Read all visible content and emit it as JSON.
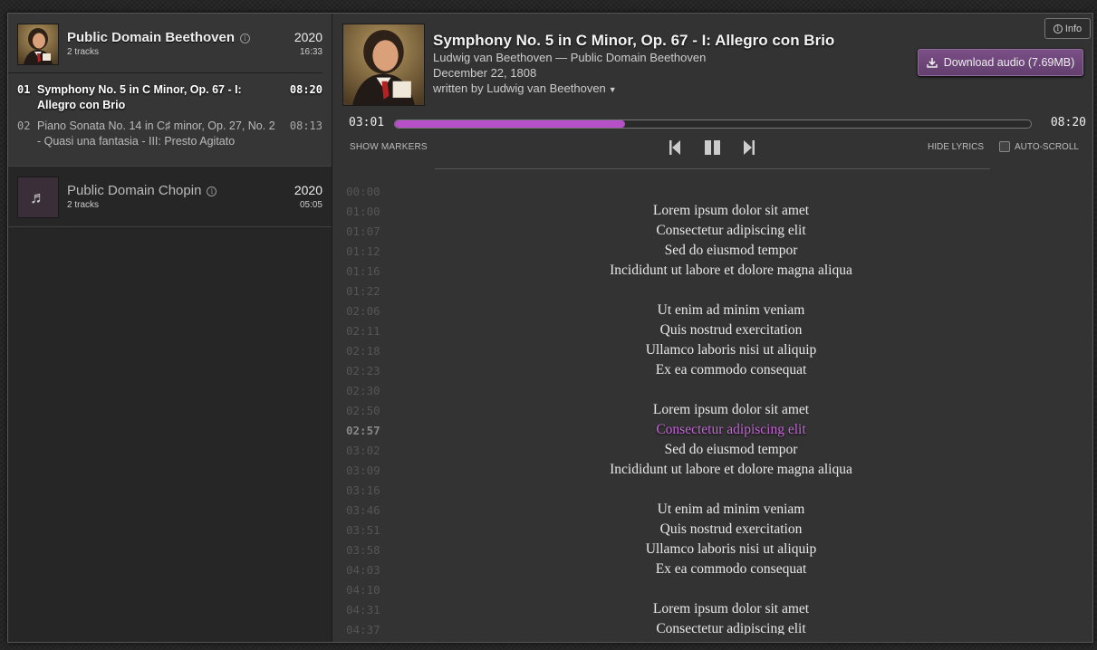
{
  "info_button": {
    "label": "Info",
    "icon": "info-icon"
  },
  "sidebar": {
    "albums": [
      {
        "title": "Public Domain Beethoven",
        "tracks_count": "2 tracks",
        "year": "2020",
        "length": "16:33",
        "tracks": [
          {
            "num": "01",
            "name": "Symphony No. 5 in C Minor, Op. 67 - I: Allegro con Brio",
            "duration": "08:20",
            "current": true
          },
          {
            "num": "02",
            "name": "Piano Sonata No. 14 in C♯ minor, Op. 27, No. 2 - Quasi una fantasia - III: Presto Agitato",
            "duration": "08:13",
            "current": false
          }
        ]
      },
      {
        "title": "Public Domain Chopin",
        "tracks_count": "2 tracks",
        "year": "2020",
        "length": "05:05",
        "cover_icon": "music-note-icon"
      }
    ]
  },
  "player": {
    "title": "Symphony No. 5 in C Minor, Op. 67 - I: Allegro con Brio",
    "artist_line": "Ludwig van Beethoven — Public Domain Beethoven",
    "date": "December 22, 1808",
    "writer": "written by Ludwig van Beethoven",
    "download_label": "Download audio (7.69MB)",
    "time_current": "03:01",
    "time_total": "08:20",
    "progress_fraction": 0.362,
    "show_markers": "SHOW MARKERS",
    "hide_lyrics": "HIDE LYRICS",
    "auto_scroll": "AUTO-SCROLL",
    "auto_scroll_checked": false,
    "accent_color": "#b64fc8"
  },
  "lyrics": [
    {
      "ts": "00:00",
      "text": ""
    },
    {
      "ts": "01:00",
      "text": "Lorem ipsum dolor sit amet"
    },
    {
      "ts": "01:07",
      "text": "Consectetur adipiscing elit"
    },
    {
      "ts": "01:12",
      "text": "Sed do eiusmod tempor"
    },
    {
      "ts": "01:16",
      "text": "Incididunt ut labore et dolore magna aliqua"
    },
    {
      "ts": "01:22",
      "text": ""
    },
    {
      "ts": "02:06",
      "text": "Ut enim ad minim veniam"
    },
    {
      "ts": "02:11",
      "text": "Quis nostrud exercitation"
    },
    {
      "ts": "02:18",
      "text": "Ullamco laboris nisi ut aliquip"
    },
    {
      "ts": "02:23",
      "text": "Ex ea commodo consequat"
    },
    {
      "ts": "02:30",
      "text": ""
    },
    {
      "ts": "02:50",
      "text": "Lorem ipsum dolor sit amet"
    },
    {
      "ts": "02:57",
      "text": "Consectetur adipiscing elit",
      "current": true
    },
    {
      "ts": "03:02",
      "text": "Sed do eiusmod tempor"
    },
    {
      "ts": "03:09",
      "text": "Incididunt ut labore et dolore magna aliqua"
    },
    {
      "ts": "03:16",
      "text": ""
    },
    {
      "ts": "03:46",
      "text": "Ut enim ad minim veniam"
    },
    {
      "ts": "03:51",
      "text": "Quis nostrud exercitation"
    },
    {
      "ts": "03:58",
      "text": "Ullamco laboris nisi ut aliquip"
    },
    {
      "ts": "04:03",
      "text": "Ex ea commodo consequat"
    },
    {
      "ts": "04:10",
      "text": ""
    },
    {
      "ts": "04:31",
      "text": "Lorem ipsum dolor sit amet"
    },
    {
      "ts": "04:37",
      "text": "Consectetur adipiscing elit"
    }
  ]
}
